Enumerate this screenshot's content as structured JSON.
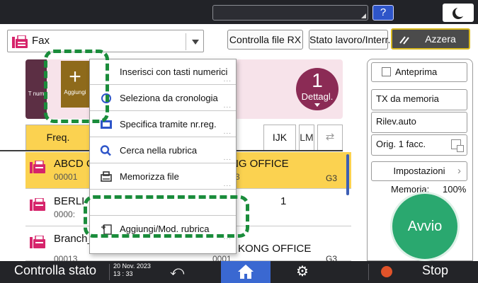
{
  "topbar": {
    "help_label": "?"
  },
  "header": {
    "app_name": "Fax",
    "rx_button": "Controlla file RX",
    "status_button": "Stato lavoro/Interr.",
    "reset_button": "Azzera"
  },
  "destination": {
    "side_label": "T num",
    "count": "1",
    "details_label": "Dettagl."
  },
  "aggiungi": {
    "plus": "+",
    "label": "Aggiungi"
  },
  "menu": {
    "items": [
      {
        "label": "Inserisci con tasti numerici",
        "dots": "..."
      },
      {
        "label": "Seleziona da cronologia",
        "dots": "..."
      },
      {
        "label": "Specifica tramite nr.reg.",
        "dots": "..."
      },
      {
        "label": "Cerca nella rubrica",
        "dots": "..."
      },
      {
        "label": "Memorizza file",
        "dots": "..."
      },
      {
        "label": "",
        "dots": ""
      },
      {
        "label": "Aggiungi/Mod. rubrica",
        "dots": "..."
      }
    ]
  },
  "tabs": {
    "freq": "Freq.",
    "ijk": "IJK",
    "lm": "LM",
    "recent": "⇄"
  },
  "contacts": [
    {
      "name": "ABCD CO",
      "number": "00001",
      "right_line1": "NG OFFICE",
      "right_line2": "3",
      "protocol": "G3"
    },
    {
      "name": "BERLI",
      "number": "0000:",
      "right_line1": "1",
      "right_line2": "",
      "protocol": ""
    },
    {
      "name": "Branch_C",
      "number": "00013",
      "right_line1": "KONG OFFICE",
      "right_line2": "0001",
      "protocol": "G3"
    }
  ],
  "right_panel": {
    "preview": "Anteprima",
    "tx_memory": "TX da memoria",
    "detect": "Rilev.auto",
    "orig": "Orig. 1 facc.",
    "settings": "Impostazioni",
    "memory_label": "Memoria:",
    "memory_value": "100%",
    "start": "Avvio"
  },
  "bottombar": {
    "status": "Controlla stato",
    "date": "20 Nov. 2023",
    "time": "13 : 33",
    "stop": "Stop"
  },
  "colors": {
    "accent_selected": "#fbd250",
    "fax_brand": "#d6246b",
    "start_green": "#2aa86f",
    "highlight_green": "#1a8c3b",
    "home_blue": "#3a68d1"
  }
}
